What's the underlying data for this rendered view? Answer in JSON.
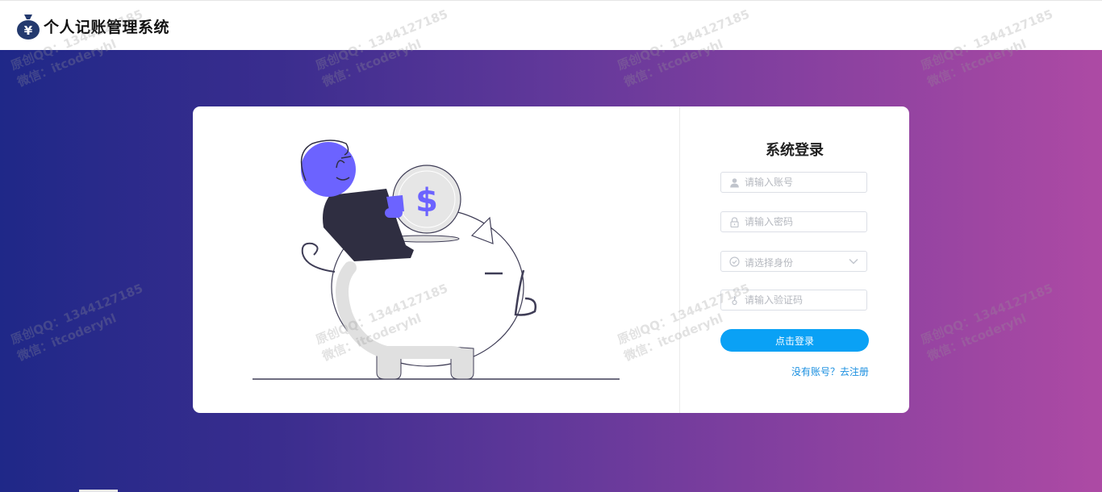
{
  "header": {
    "app_title": "个人记账管理系统",
    "logo_icon": "money-bag-yen-icon"
  },
  "login": {
    "title": "系统登录",
    "account": {
      "placeholder": "请输入账号",
      "icon": "user-icon"
    },
    "password": {
      "placeholder": "请输入密码",
      "icon": "lock-icon"
    },
    "role": {
      "placeholder": "请选择身份",
      "icon": "check-circle-icon"
    },
    "captcha": {
      "placeholder": "请输入验证码",
      "icon": "key-icon"
    },
    "submit_label": "点击登录",
    "register_link": "没有账号？去注册"
  },
  "illustration": {
    "name": "piggy-bank-coin-illustration",
    "coin_symbol": "$"
  },
  "watermark": {
    "line1": "原创QQ：1344127185",
    "line2": "微信：itcoderyhl"
  },
  "colors": {
    "gradient_start": "#1f2888",
    "gradient_end": "#ad4aa4",
    "primary_button": "#0aa1f5",
    "link": "#1a8fe0",
    "illustration_accent": "#6c63ff",
    "illustration_dark": "#2f2e41"
  }
}
